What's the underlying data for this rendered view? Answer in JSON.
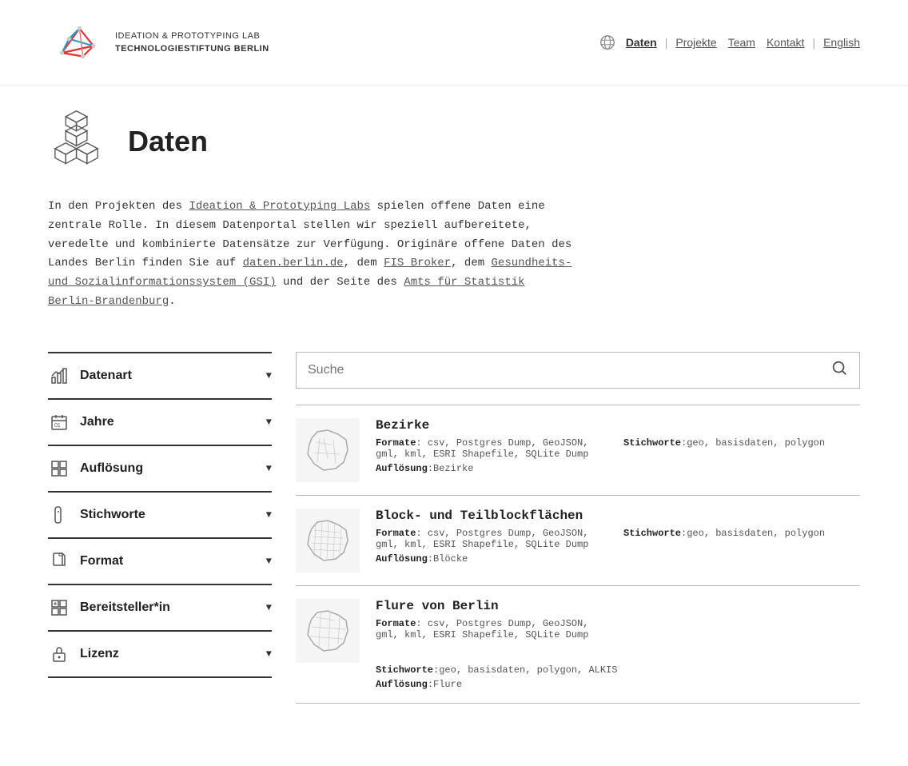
{
  "header": {
    "logo_line1": "IDEATION & PROTOTYPING LAB",
    "logo_line2": "TECHNOLOGIESTIFTUNG BERLIN",
    "nav": {
      "items": [
        {
          "label": "Daten",
          "active": true
        },
        {
          "label": "Projekte",
          "active": false
        },
        {
          "label": "Team",
          "active": false
        },
        {
          "label": "Kontakt",
          "active": false
        },
        {
          "label": "English",
          "active": false
        }
      ],
      "sep1": "|",
      "sep2": "|"
    }
  },
  "hero": {
    "title": "Daten"
  },
  "intro": {
    "text_prefix": "In den Projekten des ",
    "link1": "Ideation & Prototyping Labs",
    "text_mid1": " spielen offene Daten eine zentrale Rolle. In diesem Datenportal stellen wir speziell aufbereitete, veredelte und kombinierte Datensätze zur Verfügung. Originäre offene Daten des Landes Berlin finden Sie auf ",
    "link2": "daten.berlin.de",
    "text_mid2": ", dem ",
    "link3": "FIS Broker",
    "text_mid3": ", dem ",
    "link4": "Gesundheits- und Sozialinformationssystem (GSI)",
    "text_mid4": " und der Seite des ",
    "link5": "Amts für Statistik Berlin-Brandenburg",
    "text_end": "."
  },
  "sidebar": {
    "filters": [
      {
        "id": "datenart",
        "label": "Datenart",
        "icon": "chart-icon"
      },
      {
        "id": "jahre",
        "label": "Jahre",
        "icon": "calendar-icon"
      },
      {
        "id": "aufloesung",
        "label": "Auflösung",
        "icon": "grid-icon"
      },
      {
        "id": "stichworte",
        "label": "Stichworte",
        "icon": "tag-icon"
      },
      {
        "id": "format",
        "label": "Format",
        "icon": "doc-icon"
      },
      {
        "id": "bereitsteller",
        "label": "Bereitsteller*in",
        "icon": "building-icon"
      },
      {
        "id": "lizenz",
        "label": "Lizenz",
        "icon": "lock-icon"
      }
    ]
  },
  "search": {
    "placeholder": "Suche"
  },
  "results": [
    {
      "title": "Bezirke",
      "formats": "csv, Postgres Dump, GeoJSON, gml, kml, ESRI Shapefile, SQLite Dump",
      "stichworte": "geo, basisdaten, polygon",
      "aufloesung": "Bezirke"
    },
    {
      "title": "Block- und Teilblockflächen",
      "formats": "csv, Postgres Dump, GeoJSON, gml, kml, ESRI Shapefile, SQLite Dump",
      "stichworte": "geo, basisdaten, polygon",
      "aufloesung": "Blöcke"
    },
    {
      "title": "Flure von Berlin",
      "formats": "csv, Postgres Dump, GeoJSON, gml, kml, ESRI Shapefile, SQLite Dump",
      "stichworte": "geo, basisdaten, polygon, ALKIS",
      "aufloesung": "Flure"
    }
  ],
  "labels": {
    "formate": "Formate",
    "stichworte": "Stichworte",
    "aufloesung": "Auflösung"
  }
}
